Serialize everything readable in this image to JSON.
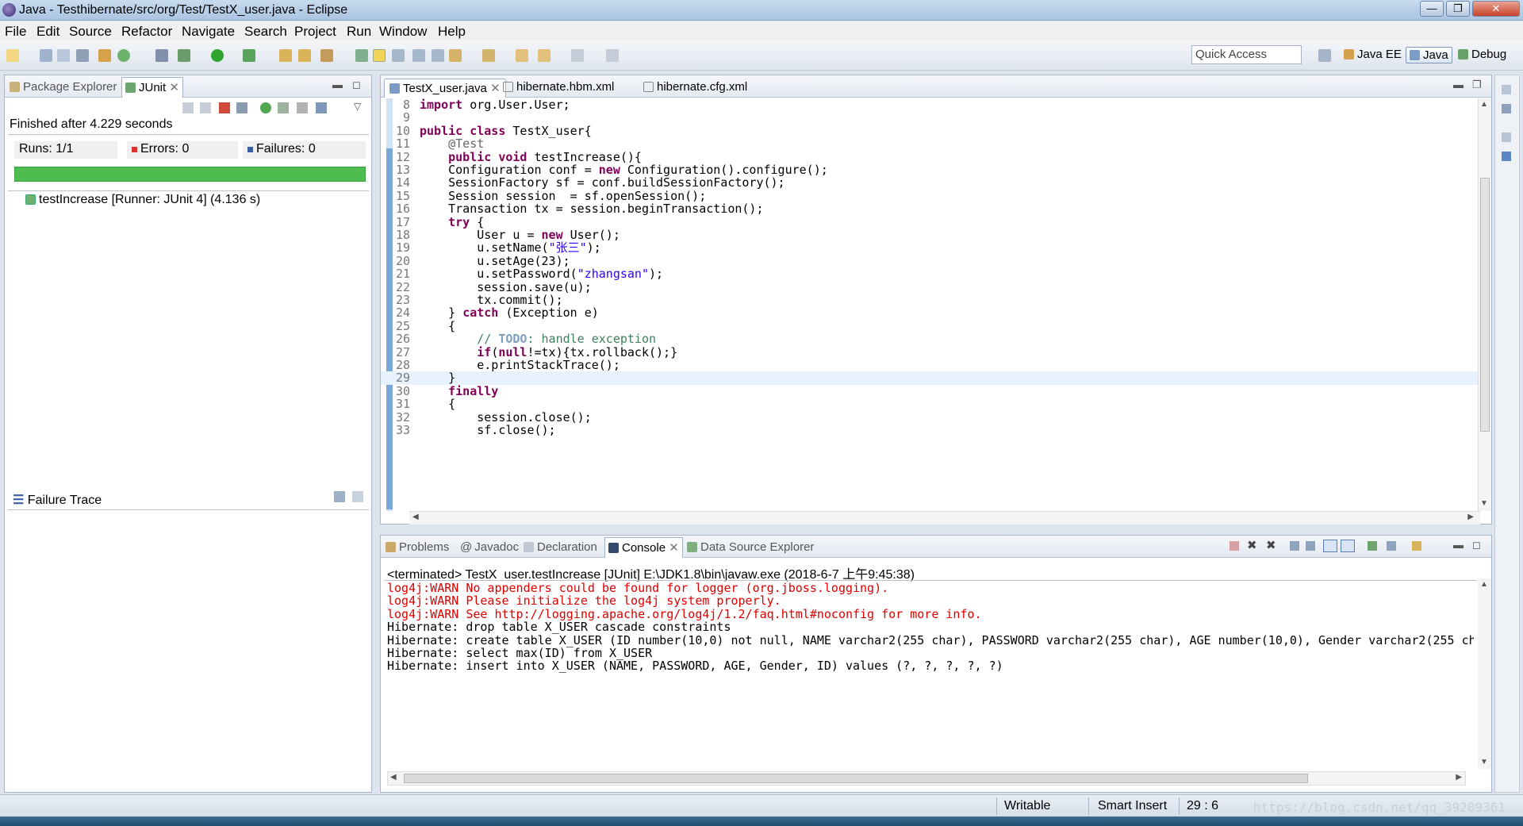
{
  "window": {
    "title": "Java - Testhibernate/src/org/Test/TestX_user.java - Eclipse",
    "minimize": "—",
    "maximize": "❐",
    "close": "✕"
  },
  "menu": [
    "File",
    "Edit",
    "Source",
    "Refactor",
    "Navigate",
    "Search",
    "Project",
    "Run",
    "Window",
    "Help"
  ],
  "toolbar": {
    "quick_access_placeholder": "Quick Access",
    "perspectives": [
      "Java EE",
      "Java",
      "Debug"
    ]
  },
  "left_panel": {
    "tabs": [
      "Package Explorer",
      "JUnit"
    ],
    "finished": "Finished after 4.229 seconds",
    "runs_label": "Runs:",
    "runs_value": "1/1",
    "errors_label": "Errors:",
    "errors_value": "0",
    "failures_label": "Failures:",
    "failures_value": "0",
    "progress": 1.0,
    "test_entry": "testIncrease [Runner: JUnit 4] (4.136 s)",
    "failure_trace": "Failure Trace"
  },
  "editor": {
    "tabs": [
      "TestX_user.java",
      "hibernate.hbm.xml",
      "hibernate.cfg.xml"
    ],
    "lines": [
      {
        "n": "8",
        "code": "import org.User.User;"
      },
      {
        "n": "9",
        "code": ""
      },
      {
        "n": "10",
        "code": "public class TestX_user{"
      },
      {
        "n": "11",
        "code": "    @Test"
      },
      {
        "n": "12",
        "code": "    public void testIncrease(){"
      },
      {
        "n": "13",
        "code": "    Configuration conf = new Configuration().configure();"
      },
      {
        "n": "14",
        "code": "    SessionFactory sf = conf.buildSessionFactory();"
      },
      {
        "n": "15",
        "code": "    Session session  = sf.openSession();"
      },
      {
        "n": "16",
        "code": "    Transaction tx = session.beginTransaction();"
      },
      {
        "n": "17",
        "code": "    try {"
      },
      {
        "n": "18",
        "code": "        User u = new User();"
      },
      {
        "n": "19",
        "code": "        u.setName(\"张三\");"
      },
      {
        "n": "20",
        "code": "        u.setAge(23);"
      },
      {
        "n": "21",
        "code": "        u.setPassword(\"zhangsan\");"
      },
      {
        "n": "22",
        "code": "        session.save(u);"
      },
      {
        "n": "23",
        "code": "        tx.commit();"
      },
      {
        "n": "24",
        "code": "    } catch (Exception e)"
      },
      {
        "n": "25",
        "code": "    {"
      },
      {
        "n": "26",
        "code": "        // TODO: handle exception"
      },
      {
        "n": "27",
        "code": "        if(null!=tx){tx.rollback();}"
      },
      {
        "n": "28",
        "code": "        e.printStackTrace();"
      },
      {
        "n": "29",
        "code": "    }"
      },
      {
        "n": "30",
        "code": "    finally"
      },
      {
        "n": "31",
        "code": "    {"
      },
      {
        "n": "32",
        "code": "        session.close();"
      },
      {
        "n": "33",
        "code": "        sf.close();"
      }
    ]
  },
  "console": {
    "tabs": [
      "Problems",
      "Javadoc",
      "Declaration",
      "Console",
      "Data Source Explorer"
    ],
    "header": "<terminated> TestX_user.testIncrease [JUnit] E:\\JDK1.8\\bin\\javaw.exe (2018-6-7 上午9:45:38)",
    "lines": [
      {
        "text": "log4j:WARN No appenders could be found for logger (org.jboss.logging).",
        "err": true
      },
      {
        "text": "log4j:WARN Please initialize the log4j system properly.",
        "err": true
      },
      {
        "text": "log4j:WARN See http://logging.apache.org/log4j/1.2/faq.html#noconfig for more info.",
        "err": true
      },
      {
        "text": "Hibernate: drop table X_USER cascade constraints",
        "err": false
      },
      {
        "text": "Hibernate: create table X_USER (ID number(10,0) not null, NAME varchar2(255 char), PASSWORD varchar2(255 char), AGE number(10,0), Gender varchar2(255 ch",
        "err": false
      },
      {
        "text": "Hibernate: select max(ID) from X_USER",
        "err": false
      },
      {
        "text": "Hibernate: insert into X_USER (NAME, PASSWORD, AGE, Gender, ID) values (?, ?, ?, ?, ?)",
        "err": false
      }
    ]
  },
  "status": {
    "writable": "Writable",
    "insert_mode": "Smart Insert",
    "position": "29 : 6"
  },
  "watermark": "https://blog.csdn.net/qq_39209361",
  "colors": {
    "keyword": "#7f0055",
    "string": "#2a00ff",
    "comment": "#3f7f5f",
    "error": "#e00000",
    "progress": "#4fbc4f"
  }
}
